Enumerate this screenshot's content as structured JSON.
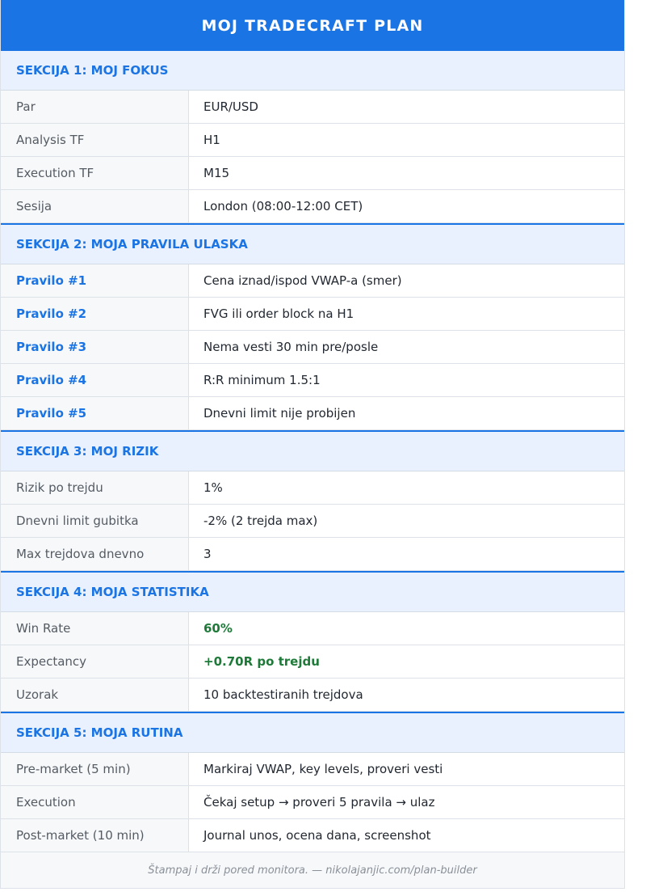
{
  "title": "MOJ TRADECRAFT PLAN",
  "colors": {
    "accent": "#1b74e4",
    "section_bg": "#e8f1fd",
    "positive": "#1f7a3a"
  },
  "sections": [
    {
      "heading": "SEKCIJA 1: MOJ FOKUS",
      "rows": [
        {
          "label": "Par",
          "value": "EUR/USD"
        },
        {
          "label": "Analysis TF",
          "value": "H1"
        },
        {
          "label": "Execution TF",
          "value": "M15"
        },
        {
          "label": "Sesija",
          "value": "London (08:00-12:00 CET)"
        }
      ]
    },
    {
      "heading": "SEKCIJA 2: MOJA PRAVILA ULASKA",
      "rows": [
        {
          "label": "Pravilo #1",
          "value": "Cena iznad/ispod VWAP-a (smer)"
        },
        {
          "label": "Pravilo #2",
          "value": "FVG ili order block na H1"
        },
        {
          "label": "Pravilo #3",
          "value": "Nema vesti 30 min pre/posle"
        },
        {
          "label": "Pravilo #4",
          "value": "R:R minimum 1.5:1"
        },
        {
          "label": "Pravilo #5",
          "value": "Dnevni limit nije probijen"
        }
      ]
    },
    {
      "heading": "SEKCIJA 3: MOJ RIZIK",
      "rows": [
        {
          "label": "Rizik po trejdu",
          "value": "1%"
        },
        {
          "label": "Dnevni limit gubitka",
          "value": "-2% (2 trejda max)"
        },
        {
          "label": "Max trejdova dnevno",
          "value": "3"
        }
      ]
    },
    {
      "heading": "SEKCIJA 4: MOJA STATISTIKA",
      "rows": [
        {
          "label": "Win Rate",
          "value": "60%"
        },
        {
          "label": "Expectancy",
          "value": "+0.70R po trejdu"
        },
        {
          "label": "Uzorak",
          "value": "10 backtestiranih trejdova"
        }
      ]
    },
    {
      "heading": "SEKCIJA 5: MOJA RUTINA",
      "rows": [
        {
          "label": "Pre-market (5 min)",
          "value": "Markiraj VWAP, key levels, proveri vesti"
        },
        {
          "label": "Execution",
          "value": "Čekaj setup → proveri 5 pravila → ulaz"
        },
        {
          "label": "Post-market (10 min)",
          "value": "Journal unos, ocena dana, screenshot"
        }
      ]
    }
  ],
  "footer": "Štampaj i drži pored monitora. — nikolajanjic.com/plan-builder"
}
